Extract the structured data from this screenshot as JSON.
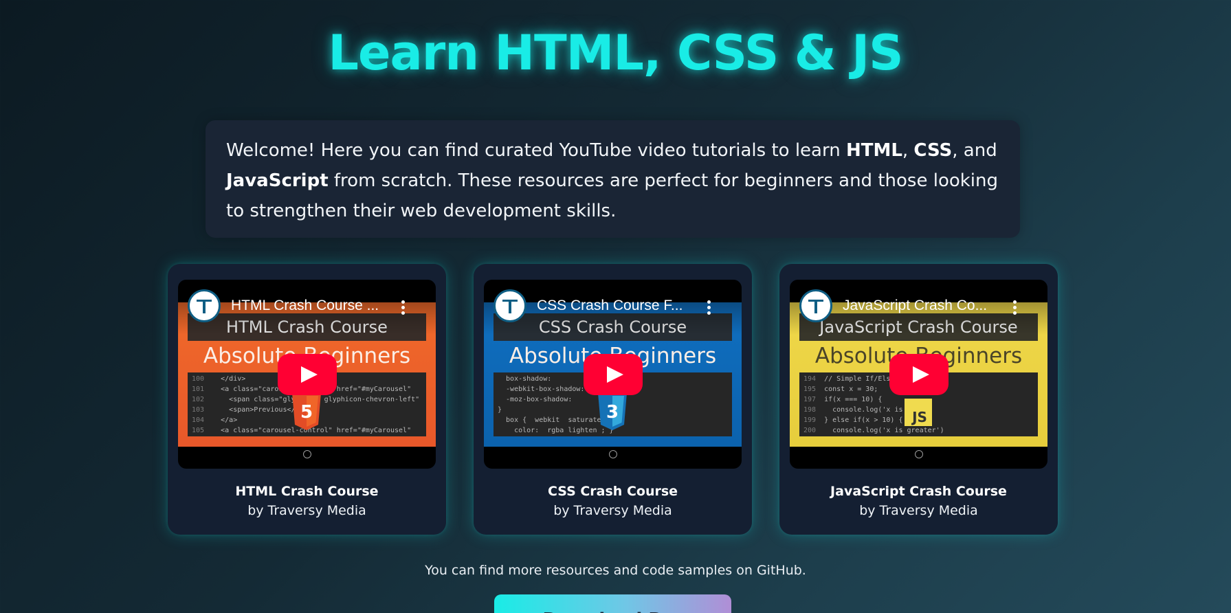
{
  "page_title": "Learn HTML, CSS & JS",
  "intro": {
    "part1": "Welcome! Here you can find curated YouTube video tutorials to learn ",
    "html": "HTML",
    "sep1": ", ",
    "css": "CSS",
    "sep2": ", and ",
    "js": "JavaScript",
    "part2": " from scratch. These resources are perfect for beginners and those looking to strengthen their web development skills."
  },
  "videos": [
    {
      "player_title": "HTML Crash Course ...",
      "thumb_title": "HTML Crash Course",
      "thumb_subtitle": "Absolute Beginners",
      "badge": "5",
      "card_title": "HTML Crash Course",
      "author": "by Traversy Media",
      "accent": "#f06a2a"
    },
    {
      "player_title": "CSS Crash Course F...",
      "thumb_title": "CSS Crash Course",
      "thumb_subtitle": "Absolute Beginners",
      "badge": "3",
      "card_title": "CSS Crash Course",
      "author": "by Traversy Media",
      "accent": "#106fc0"
    },
    {
      "player_title": "JavaScript Crash Co...",
      "thumb_title": "JavaScript Crash Course",
      "thumb_subtitle": "Absolute Beginners",
      "badge": "JS",
      "card_title": "JavaScript Crash Course",
      "author": "by Traversy Media",
      "accent": "#f0d84a"
    }
  ],
  "footer_note": "You can find more resources and code samples on GitHub.",
  "download_label": "Download R...",
  "colors": {
    "title": "#19ece6",
    "card_bg": "#141f32",
    "play_button": "#ff0033"
  }
}
